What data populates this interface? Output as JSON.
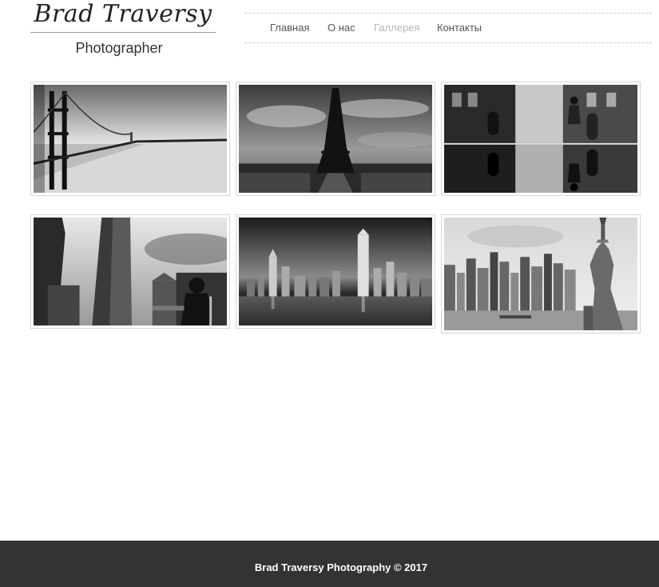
{
  "header": {
    "logo_title": "Brad Traversy",
    "logo_subtitle": "Photographer"
  },
  "nav": {
    "items": [
      {
        "label": "Главная",
        "active": false
      },
      {
        "label": "О нас",
        "active": false
      },
      {
        "label": "Галлерея",
        "active": true
      },
      {
        "label": "Контакты",
        "active": false
      }
    ],
    "active_color": "#b5b5b5",
    "text_color": "#555555"
  },
  "gallery": {
    "images": [
      {
        "subject": "golden-gate-bridge"
      },
      {
        "subject": "eiffel-tower"
      },
      {
        "subject": "boy-running-street-reflection"
      },
      {
        "subject": "flatiron-building"
      },
      {
        "subject": "hong-kong-skyline"
      },
      {
        "subject": "new-york-statue-of-liberty"
      }
    ]
  },
  "footer": {
    "text": "Brad Traversy Photography © 2017",
    "background": "#333333"
  }
}
